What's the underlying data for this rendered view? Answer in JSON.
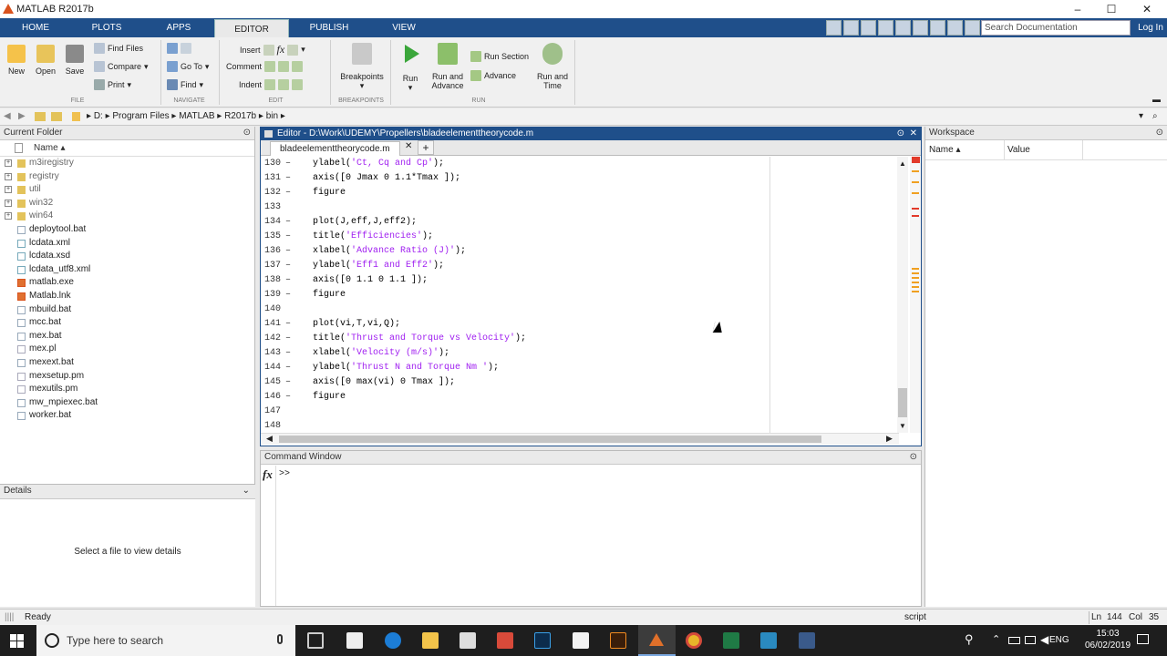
{
  "window": {
    "title": "MATLAB R2017b"
  },
  "tabs": [
    "HOME",
    "PLOTS",
    "APPS",
    "EDITOR",
    "PUBLISH",
    "VIEW"
  ],
  "search": {
    "placeholder": "Search Documentation"
  },
  "login": "Log In",
  "ribbon": {
    "new": "New",
    "open": "Open",
    "save": "Save",
    "find_files": "Find Files",
    "compare": "Compare",
    "print": "Print",
    "go_to": "Go To",
    "find": "Find",
    "insert": "Insert",
    "comment": "Comment",
    "indent": "Indent",
    "breakpoints": "Breakpoints",
    "run": "Run",
    "run_advance_1": "Run and",
    "run_advance_2": "Advance",
    "run_section": "Run Section",
    "advance": "Advance",
    "run_time_1": "Run and",
    "run_time_2": "Time",
    "groups": {
      "file": "FILE",
      "navigate": "NAVIGATE",
      "edit": "EDIT",
      "breakpoints": "BREAKPOINTS",
      "run": "RUN"
    }
  },
  "address": {
    "drive": "D:",
    "path": [
      "Program Files",
      "MATLAB",
      "R2017b",
      "bin"
    ]
  },
  "current_folder": {
    "title": "Current Folder",
    "col_name": "Name",
    "folders": [
      "m3iregistry",
      "registry",
      "util",
      "win32",
      "win64"
    ],
    "files": [
      "deploytool.bat",
      "lcdata.xml",
      "lcdata.xsd",
      "lcdata_utf8.xml",
      "matlab.exe",
      "Matlab.lnk",
      "mbuild.bat",
      "mcc.bat",
      "mex.bat",
      "mex.pl",
      "mexext.bat",
      "mexsetup.pm",
      "mexutils.pm",
      "mw_mpiexec.bat",
      "worker.bat"
    ]
  },
  "details": {
    "title": "Details",
    "message": "Select a file to view details"
  },
  "editor": {
    "title": "Editor - D:\\Work\\UDEMY\\Propellers\\bladeelementtheorycode.m",
    "file_tab": "bladeelementtheorycode.m",
    "add_tab": "+",
    "lines": [
      {
        "n": "130",
        "d": "–",
        "pre": "ylabel(",
        "s": "'Ct, Cq and Cp'",
        "post": ");"
      },
      {
        "n": "131",
        "d": "–",
        "pre": "axis([0 Jmax 0 1.1*Tmax ]);",
        "s": "",
        "post": ""
      },
      {
        "n": "132",
        "d": "–",
        "pre": "figure",
        "s": "",
        "post": ""
      },
      {
        "n": "133",
        "d": "",
        "pre": "",
        "s": "",
        "post": ""
      },
      {
        "n": "134",
        "d": "–",
        "pre": "plot(J,eff,J,eff2);",
        "s": "",
        "post": ""
      },
      {
        "n": "135",
        "d": "–",
        "pre": "title(",
        "s": "'Efficiencies'",
        "post": ");"
      },
      {
        "n": "136",
        "d": "–",
        "pre": "xlabel(",
        "s": "'Advance Ratio (J)'",
        "post": ");"
      },
      {
        "n": "137",
        "d": "–",
        "pre": "ylabel(",
        "s": "'Eff1 and Eff2'",
        "post": ");"
      },
      {
        "n": "138",
        "d": "–",
        "pre": "axis([0 1.1 0 1.1 ]);",
        "s": "",
        "post": ""
      },
      {
        "n": "139",
        "d": "–",
        "pre": "figure",
        "s": "",
        "post": ""
      },
      {
        "n": "140",
        "d": "",
        "pre": "",
        "s": "",
        "post": ""
      },
      {
        "n": "141",
        "d": "–",
        "pre": "plot(vi,T,vi,Q);",
        "s": "",
        "post": ""
      },
      {
        "n": "142",
        "d": "–",
        "pre": "title(",
        "s": "'Thrust and Torque vs Velocity'",
        "post": ");"
      },
      {
        "n": "143",
        "d": "–",
        "pre": "xlabel(",
        "s": "'Velocity (m/s)'",
        "post": ");"
      },
      {
        "n": "144",
        "d": "–",
        "pre": "ylabel(",
        "s": "'Thrust N and Torque Nm '",
        "post": ");"
      },
      {
        "n": "145",
        "d": "–",
        "pre": "axis([0 max(vi) 0 Tmax ]);",
        "s": "",
        "post": ""
      },
      {
        "n": "146",
        "d": "–",
        "pre": "figure",
        "s": "",
        "post": ""
      },
      {
        "n": "147",
        "d": "",
        "pre": "",
        "s": "",
        "post": ""
      },
      {
        "n": "148",
        "d": "",
        "pre": "",
        "s": "",
        "post": ""
      }
    ]
  },
  "command_window": {
    "title": "Command Window",
    "fx": "fx",
    "prompt": ">>"
  },
  "workspace": {
    "title": "Workspace",
    "col_name": "Name",
    "col_value": "Value"
  },
  "status": {
    "state": "Ready",
    "mode": "script",
    "ln_label": "Ln",
    "ln": "144",
    "col_label": "Col",
    "col": "35"
  },
  "taskbar": {
    "search_placeholder": "Type here to search",
    "lang": "ENG",
    "time": "15:03",
    "date": "06/02/2019"
  },
  "colors": {
    "title_blue": "#1f4f8a",
    "string_purple": "#a020f0"
  }
}
